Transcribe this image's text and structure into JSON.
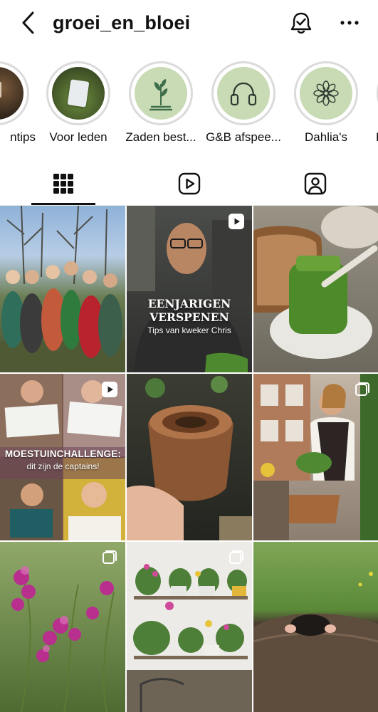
{
  "header": {
    "username": "groei_en_bloei",
    "back_icon": "chevron-left-icon",
    "notification_icon": "bell-check-icon",
    "more_icon": "more-horizontal-icon"
  },
  "highlights": [
    {
      "label": "ntips"
    },
    {
      "label": "Voor leden"
    },
    {
      "label": "Zaden best..."
    },
    {
      "label": "G&B afspee..."
    },
    {
      "label": "Dahlia's"
    },
    {
      "label": "K"
    }
  ],
  "tabs": [
    {
      "icon": "grid-icon",
      "active": true
    },
    {
      "icon": "reels-icon",
      "active": false
    },
    {
      "icon": "tagged-icon",
      "active": false
    }
  ],
  "posts": [
    {
      "subject": "group-photo",
      "badge": ""
    },
    {
      "subject": "kweker-chris",
      "badge": "reel-icon",
      "title_line1": "EENJARIGEN",
      "title_line2": "VERSPENEN",
      "subtitle": "Tips van kweker Chris"
    },
    {
      "subject": "pesto-jar",
      "badge": ""
    },
    {
      "subject": "moestuinchallenge",
      "badge": "reel-icon",
      "title": "MOESTUINCHALLENGE:",
      "subtitle": "dit zijn de captains!"
    },
    {
      "subject": "paper-pot",
      "badge": ""
    },
    {
      "subject": "balcony-woman",
      "badge": "carousel-icon"
    },
    {
      "subject": "sweet-peas",
      "badge": "carousel-icon"
    },
    {
      "subject": "plant-shelves",
      "badge": "carousel-icon"
    },
    {
      "subject": "mole",
      "badge": ""
    }
  ],
  "colors": {
    "highlight_sage": "#c8dbb4",
    "icon_green": "#3f6f4a",
    "ring": "#dbdbdb"
  }
}
